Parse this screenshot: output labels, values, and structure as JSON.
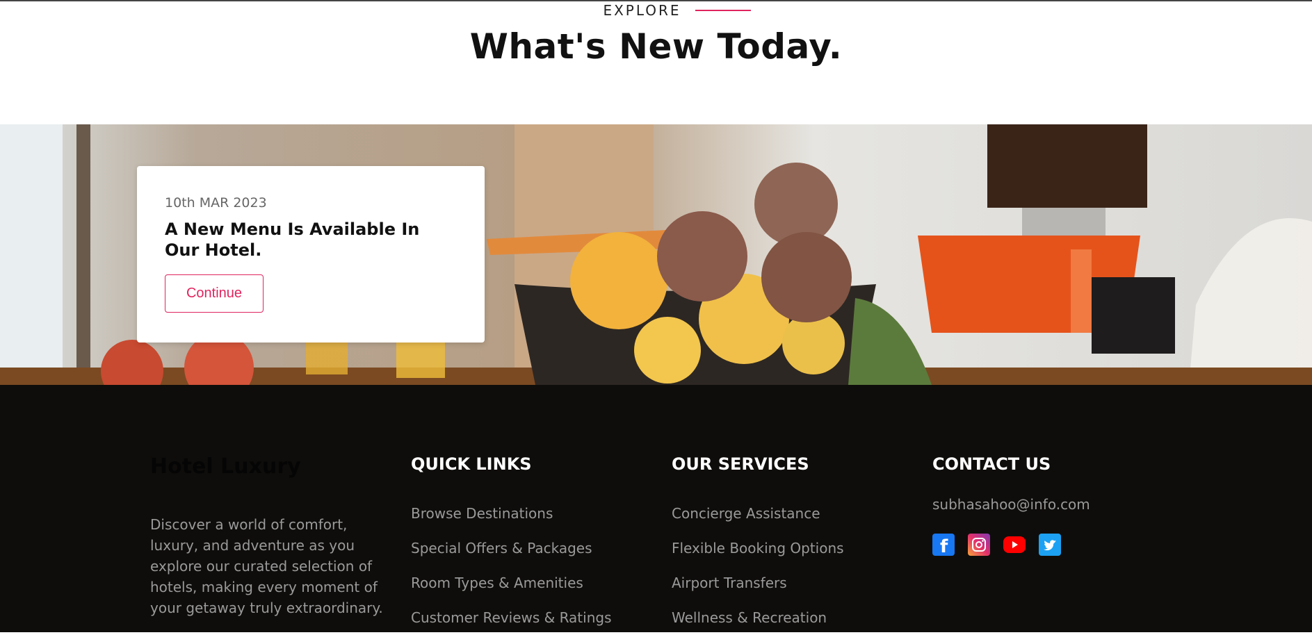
{
  "section": {
    "eyebrow": "EXPLORE",
    "headline": "What's New Today."
  },
  "banner": {
    "image": "fruit-basket-kitchen-photo",
    "card": {
      "date": "10th MAR 2023",
      "title": "A New Menu Is Available In Our Hotel.",
      "button_label": "Continue"
    }
  },
  "footer": {
    "brand": "Hotel Luxury",
    "about": "Discover a world of comfort, luxury, and adventure as you explore our curated selection of hotels, making every moment of your getaway truly extraordinary.",
    "quick_links": {
      "heading": "QUICK LINKS",
      "items": [
        "Browse Destinations",
        "Special Offers & Packages",
        "Room Types & Amenities",
        "Customer Reviews & Ratings"
      ]
    },
    "services": {
      "heading": "OUR SERVICES",
      "items": [
        "Concierge Assistance",
        "Flexible Booking Options",
        "Airport Transfers",
        "Wellness & Recreation"
      ]
    },
    "contact": {
      "heading": "CONTACT US",
      "email": "subhasahoo@info.com",
      "socials": [
        "facebook-icon",
        "instagram-icon",
        "youtube-icon",
        "twitter-icon"
      ]
    }
  },
  "colors": {
    "accent": "#e0245e",
    "footer_bg": "#0f0d0b"
  }
}
